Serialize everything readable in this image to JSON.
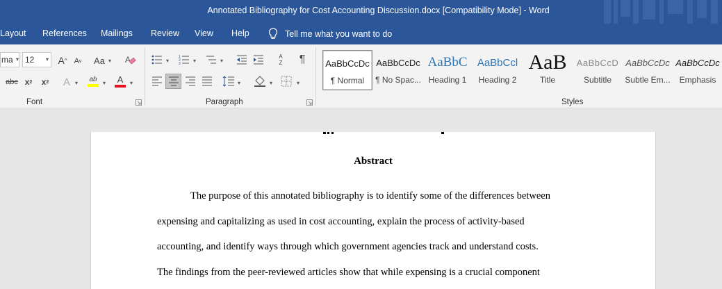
{
  "window": {
    "title": "Annotated Bibliography for Cost Accounting Discussion.docx [Compatibility Mode]  -  Word"
  },
  "tabs": [
    {
      "label": "Layout"
    },
    {
      "label": "References"
    },
    {
      "label": "Mailings"
    },
    {
      "label": "Review"
    },
    {
      "label": "View"
    },
    {
      "label": "Help"
    }
  ],
  "tellme": {
    "label": "Tell me what you want to do"
  },
  "font_group": {
    "label": "Font",
    "font_name": "ma",
    "font_size": "12",
    "grow_label": "A",
    "shrink_label": "A",
    "change_case_label": "Aa",
    "strike_label": "abc",
    "subscript_label": "x",
    "subscript_mark": "2",
    "superscript_label": "x",
    "superscript_mark": "2",
    "effects_label": "A",
    "highlight_label": "ab",
    "font_color_label": "A",
    "highlight_color": "#ffff00",
    "font_color": "#e81123"
  },
  "paragraph_group": {
    "label": "Paragraph",
    "sort_label": "A",
    "sort_label_2": "Z",
    "pilcrow": "¶"
  },
  "styles_group": {
    "label": "Styles",
    "items": [
      {
        "preview": "AaBbCcDc",
        "name": "¶ Normal",
        "selected": true
      },
      {
        "preview": "AaBbCcDc",
        "name": "¶ No Spac..."
      },
      {
        "preview": "AaBbC",
        "name": "Heading 1"
      },
      {
        "preview": "AaBbCcl",
        "name": "Heading 2"
      },
      {
        "preview": "AaB",
        "name": "Title"
      },
      {
        "preview": "AaBbCcD",
        "name": "Subtitle"
      },
      {
        "preview": "AaBbCcDc",
        "name": "Subtle Em..."
      },
      {
        "preview": "AaBbCcDc",
        "name": "Emphasis"
      }
    ]
  },
  "document": {
    "heading": "Abstract",
    "lines": [
      "The purpose of this annotated bibliography is to identify some of the differences between",
      "expensing and capitalizing as used in cost accounting, explain the process of activity-based",
      "accounting, and identify ways through which government agencies track and understand costs.",
      "The findings from the peer-reviewed articles show that while expensing is a crucial component"
    ]
  },
  "colors": {
    "titlebar": "#2b579a",
    "ribbon": "#f3f3f3",
    "heading_blue": "#2e74b5",
    "page": "#ffffff"
  }
}
